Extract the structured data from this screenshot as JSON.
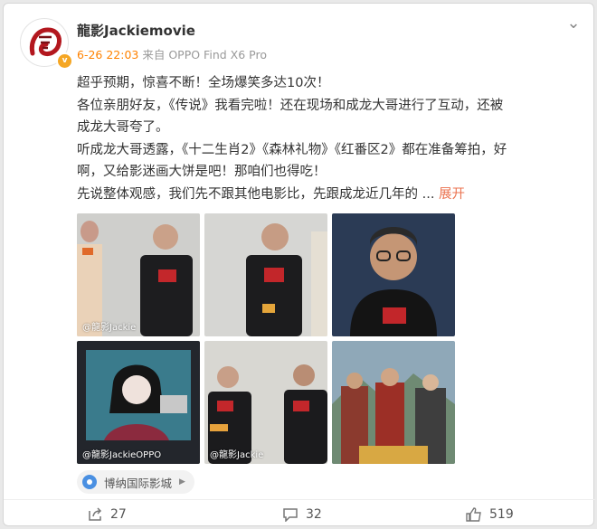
{
  "post": {
    "username": "龍影Jackiemovie",
    "time": "6-26 22:03",
    "source": "来自 OPPO Find X6 Pro",
    "lines": [
      "超乎预期，惊喜不断！全场爆笑多达10次！",
      "各位亲朋好友，《传说》我看完啦！还在现场和成龙大哥进行了互动，还被成龙大哥夸了。",
      "听成龙大哥透露，《十二生肖2》《森林礼物》《红番区2》都在准备筹拍，好啊，又给影迷画大饼是吧！那咱们也得吃！",
      "先说整体观感，我们先不跟其他电影比，先跟成龙近几年的 ..."
    ],
    "expand_label": "展开",
    "watermarks": {
      "p1": "@龍影Jackie",
      "p4": "@龍影JackieOPPO",
      "p5": "@龍影Jackie"
    },
    "location": "博纳国际影城",
    "actions": {
      "share_count": "27",
      "comment_count": "32",
      "like_count": "519"
    }
  },
  "colors": {
    "accent": "#ff8200",
    "expand": "#eb7350",
    "location_pin": "#4a90e2",
    "vip_badge": "#f5a623"
  },
  "icons": [
    "dragon-avatar-logo",
    "verified-badge-icon",
    "more-chevron-icon",
    "location-pin-icon",
    "share-icon",
    "comment-icon",
    "like-icon"
  ]
}
